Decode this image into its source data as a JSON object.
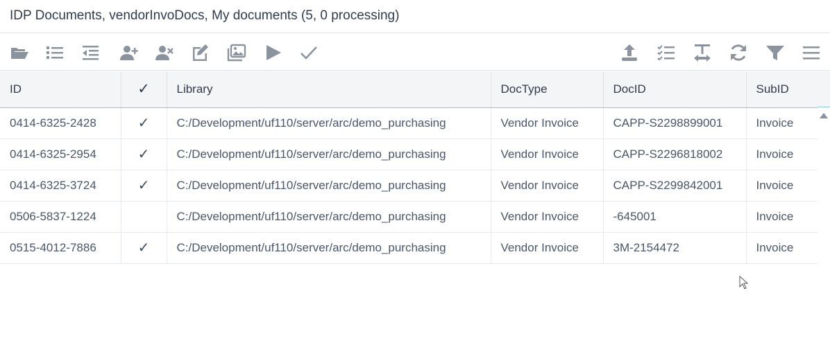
{
  "window": {
    "title": "IDP Documents, vendorInvoDocs, My documents (5, 0 processing)"
  },
  "toolbar": {
    "left_icons": [
      "folder-open-icon",
      "list-icon",
      "indent-left-icon",
      "user-add-icon",
      "user-remove-icon",
      "edit-icon",
      "images-icon",
      "play-icon",
      "check-icon"
    ],
    "right_icons": [
      "upload-icon",
      "checklist-icon",
      "text-width-icon",
      "refresh-icon",
      "filter-icon",
      "menu-icon"
    ]
  },
  "table": {
    "headers": {
      "id": "ID",
      "check": "✓",
      "library": "Library",
      "doctype": "DocType",
      "docid": "DocID",
      "subid": "SubID"
    },
    "rows": [
      {
        "id": "0414-6325-2428",
        "check": "✓",
        "library": "C:/Development/uf110/server/arc/demo_purchasing",
        "doctype": "Vendor Invoice",
        "docid": "CAPP-S2298899001",
        "subid": "Invoice"
      },
      {
        "id": "0414-6325-2954",
        "check": "✓",
        "library": "C:/Development/uf110/server/arc/demo_purchasing",
        "doctype": "Vendor Invoice",
        "docid": "CAPP-S2296818002",
        "subid": "Invoice"
      },
      {
        "id": "0414-6325-3724",
        "check": "✓",
        "library": "C:/Development/uf110/server/arc/demo_purchasing",
        "doctype": "Vendor Invoice",
        "docid": "CAPP-S2299842001",
        "subid": "Invoice"
      },
      {
        "id": "0506-5837-1224",
        "check": "",
        "library": "C:/Development/uf110/server/arc/demo_purchasing",
        "doctype": "Vendor Invoice",
        "docid": "-645001",
        "subid": "Invoice"
      },
      {
        "id": "0515-4012-7886",
        "check": "✓",
        "library": "C:/Development/uf110/server/arc/demo_purchasing",
        "doctype": "Vendor Invoice",
        "docid": "3M-2154472",
        "subid": "Invoice"
      }
    ]
  },
  "colors": {
    "icon": "#8a939e",
    "header_bg": "#f3f5f7",
    "header_underline": "#8fc6d6"
  }
}
